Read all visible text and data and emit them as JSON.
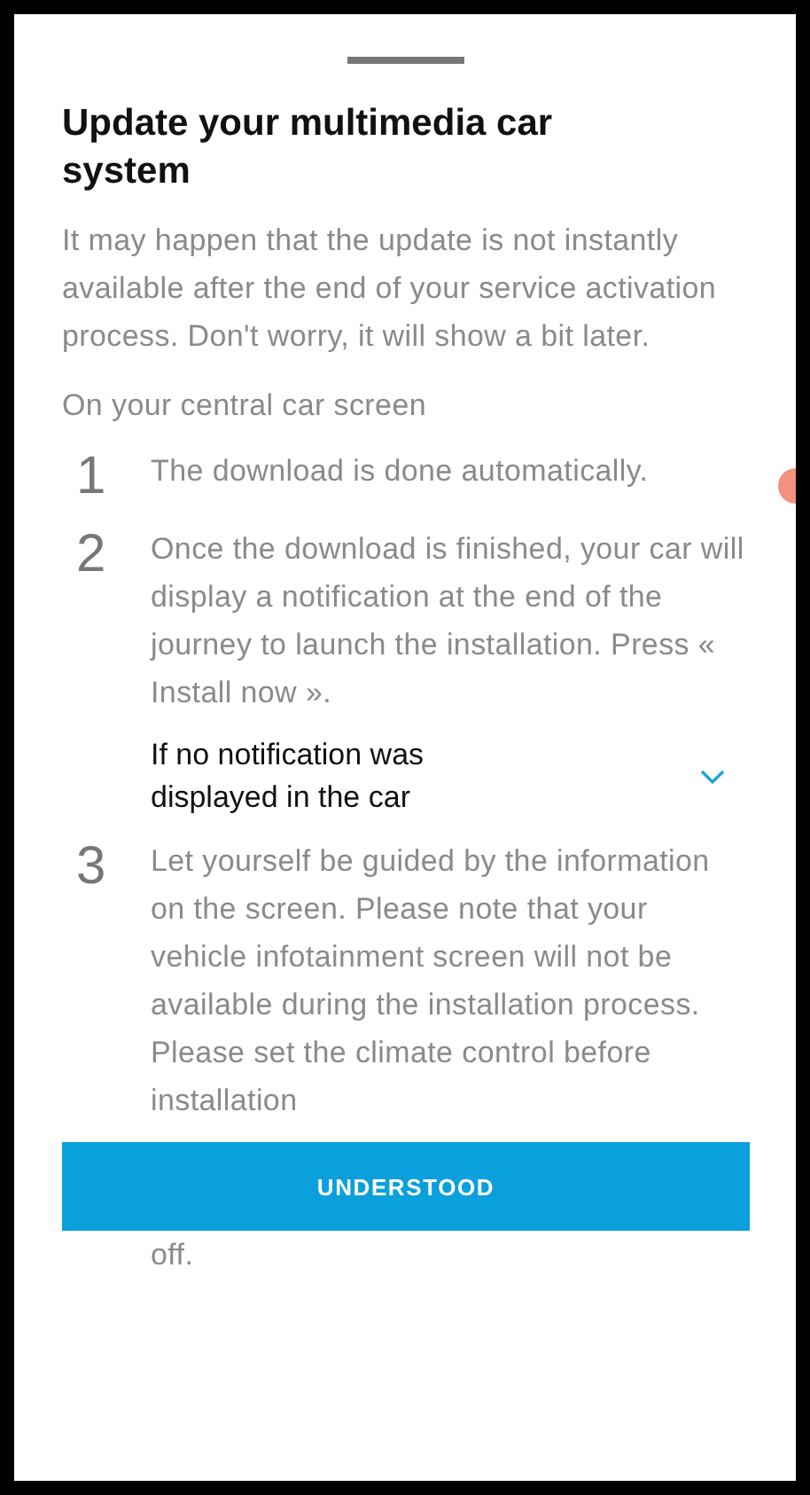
{
  "sheet": {
    "title": "Update your multimedia car system",
    "intro": "It may happen that the update is not instantly available after the end of your service activation process. Don't worry, it will show a bit later.",
    "subheading": "On your central car screen",
    "steps": [
      {
        "kind": "step",
        "number": "1",
        "text": "The download is done automatically."
      },
      {
        "kind": "step",
        "number": "2",
        "text": "Once the download is finished, your car will display a notification at the end of the journey to launch the installation. Press « Install now »."
      },
      {
        "kind": "accordion",
        "text": "If no notification was displayed in the car",
        "expanded": false
      },
      {
        "kind": "step",
        "number": "3",
        "text": "Let yourself be guided by the information on the screen. Please note that your vehicle infotainment screen will not be available during the installation process. Please set the climate control before installation"
      }
    ],
    "button": "UNDERSTOOD",
    "trailing_text": "off."
  }
}
